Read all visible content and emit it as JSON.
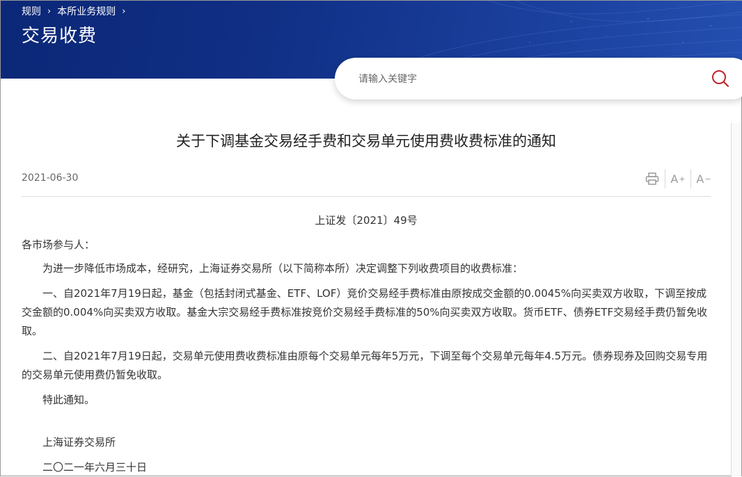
{
  "breadcrumb": {
    "items": [
      "规则",
      "本所业务规则"
    ],
    "separator": "›"
  },
  "header": {
    "title": "交易收费"
  },
  "search": {
    "placeholder": "请输入关键字",
    "value": ""
  },
  "article": {
    "title": "关于下调基金交易经手费和交易单元使用费收费标准的通知",
    "date": "2021-06-30",
    "tools": {
      "print_icon": "printer-icon",
      "font_increase_label": "A",
      "font_increase_mark": "+",
      "font_decrease_label": "A",
      "font_decrease_mark": "−"
    },
    "doc_number": "上证发〔2021〕49号",
    "salutation": "各市场参与人：",
    "paragraphs": [
      "为进一步降低市场成本，经研究，上海证券交易所（以下简称本所）决定调整下列收费项目的收费标准：",
      "一、自2021年7月19日起，基金（包括封闭式基金、ETF、LOF）竞价交易经手费标准由原按成交金额的0.0045%向买卖双方收取，下调至按成交金额的0.004%向买卖双方收取。基金大宗交易经手费标准按竞价交易经手费标准的50%向买卖双方收取。货币ETF、债券ETF交易经手费仍暂免收取。",
      "二、自2021年7月19日起，交易单元使用费收费标准由原每个交易单元每年5万元，下调至每个交易单元每年4.5万元。债券现券及回购交易专用的交易单元使用费仍暂免收取。",
      "特此通知。"
    ],
    "signature": "上海证券交易所",
    "sign_date": "二〇二一年六月三十日"
  },
  "colors": {
    "banner_dark": "#0b2777",
    "banner_light": "#244fb0",
    "search_icon": "#c0252a",
    "tool_icon": "#9a9a9a"
  }
}
